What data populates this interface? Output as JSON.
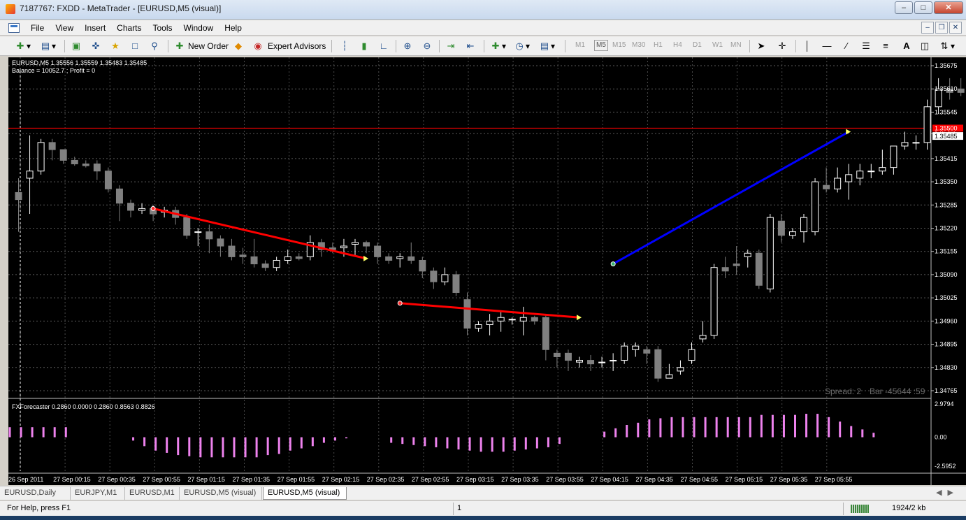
{
  "window": {
    "title": "7187767: FXDD - MetaTrader - [EURUSD,M5 (visual)]"
  },
  "menu": [
    "File",
    "View",
    "Insert",
    "Charts",
    "Tools",
    "Window",
    "Help"
  ],
  "toolbar": {
    "new_order": "New Order",
    "expert_advisors": "Expert Advisors",
    "timeframes": [
      "M1",
      "M5",
      "M15",
      "M30",
      "H1",
      "H4",
      "D1",
      "W1",
      "MN"
    ],
    "text_tool": "A"
  },
  "chart": {
    "info_line": "EURUSD,M5  1.35556 1.35559 1.35483 1.35485",
    "balance_line": "Balance = 10052.7 ; Profit = 0",
    "spread_text": "Spread: 2",
    "bar_text": "Bar  -45644 :59",
    "current_price": "1.35485",
    "price_line_label": "1.35500",
    "price_ticks": [
      "1.35675",
      "1.35610",
      "1.35545",
      "1.35485",
      "1.35415",
      "1.35350",
      "1.35285",
      "1.35220",
      "1.35155",
      "1.35090",
      "1.35025",
      "1.34960",
      "1.34895",
      "1.34830",
      "1.34765"
    ],
    "indicator_label": "FXForecaster 0.2860 0.0000 0.2860 0.8563 0.8826",
    "indicator_ticks": [
      "2.9794",
      "0.00",
      "-2.5952"
    ],
    "time_labels": [
      "26 Sep 2011",
      "27 Sep 00:15",
      "27 Sep 00:35",
      "27 Sep 00:55",
      "27 Sep 01:15",
      "27 Sep 01:35",
      "27 Sep 01:55",
      "27 Sep 02:15",
      "27 Sep 02:35",
      "27 Sep 02:55",
      "27 Sep 03:15",
      "27 Sep 03:35",
      "27 Sep 03:55",
      "27 Sep 04:15",
      "27 Sep 04:35",
      "27 Sep 04:55",
      "27 Sep 05:15",
      "27 Sep 05:35",
      "27 Sep 05:55"
    ],
    "colors": {
      "up": "#ffffff",
      "down": "#808080",
      "loss_trade": "#ff0000",
      "win_trade": "#0000ff",
      "indicator": "#ee82ee",
      "price_line": "#ff0000"
    },
    "candles": [
      [
        1.3532,
        1.353,
        1.3536,
        1.3521
      ],
      [
        1.3536,
        1.3538,
        1.3548,
        1.3526
      ],
      [
        1.3538,
        1.3546,
        1.3547,
        1.3537
      ],
      [
        1.3546,
        1.3544,
        1.3547,
        1.3541
      ],
      [
        1.3544,
        1.3541,
        1.3544,
        1.354
      ],
      [
        1.3541,
        1.354,
        1.3542,
        1.35395
      ],
      [
        1.354,
        1.35395,
        1.3541,
        1.3539
      ],
      [
        1.354,
        1.3538,
        1.3541,
        1.35355
      ],
      [
        1.3538,
        1.3533,
        1.3539,
        1.3532
      ],
      [
        1.3533,
        1.3529,
        1.3534,
        1.3524
      ],
      [
        1.3529,
        1.3527,
        1.353,
        1.3525
      ],
      [
        1.3527,
        1.35275,
        1.3529,
        1.3526
      ],
      [
        1.35275,
        1.3526,
        1.35285,
        1.3524
      ],
      [
        1.35265,
        1.3527,
        1.3528,
        1.3525
      ],
      [
        1.3527,
        1.3525,
        1.3528,
        1.3523
      ],
      [
        1.3525,
        1.352,
        1.3526,
        1.3519
      ],
      [
        1.3521,
        1.3521,
        1.3522,
        1.3517
      ],
      [
        1.3521,
        1.3519,
        1.3523,
        1.3515
      ],
      [
        1.3519,
        1.3517,
        1.352,
        1.3514
      ],
      [
        1.3517,
        1.3514,
        1.3519,
        1.3513
      ],
      [
        1.35145,
        1.3514,
        1.35165,
        1.3512
      ],
      [
        1.3514,
        1.3512,
        1.3519,
        1.3511
      ],
      [
        1.3512,
        1.3511,
        1.3513,
        1.351
      ],
      [
        1.3511,
        1.3513,
        1.3514,
        1.351
      ],
      [
        1.3513,
        1.3514,
        1.3516,
        1.3512
      ],
      [
        1.3514,
        1.35135,
        1.3515,
        1.3513
      ],
      [
        1.3514,
        1.3518,
        1.352,
        1.3513
      ],
      [
        1.3518,
        1.3516,
        1.3519,
        1.3514
      ],
      [
        1.35165,
        1.3516,
        1.3518,
        1.3515
      ],
      [
        1.35165,
        1.3517,
        1.3519,
        1.3514
      ],
      [
        1.35175,
        1.3518,
        1.3519,
        1.3514
      ],
      [
        1.3518,
        1.3517,
        1.35185,
        1.3515
      ],
      [
        1.3517,
        1.3514,
        1.3518,
        1.3512
      ],
      [
        1.3514,
        1.3513,
        1.3515,
        1.3512
      ],
      [
        1.35135,
        1.3514,
        1.3515,
        1.3511
      ],
      [
        1.3514,
        1.3513,
        1.3518,
        1.3512
      ],
      [
        1.3513,
        1.351,
        1.3514,
        1.3508
      ],
      [
        1.351,
        1.3507,
        1.3511,
        1.3505
      ],
      [
        1.3507,
        1.3509,
        1.3511,
        1.3506
      ],
      [
        1.3509,
        1.3504,
        1.351,
        1.3503
      ],
      [
        1.3502,
        1.3494,
        1.3504,
        1.3492
      ],
      [
        1.3494,
        1.3495,
        1.3496,
        1.3493
      ],
      [
        1.3495,
        1.3496,
        1.3498,
        1.3492
      ],
      [
        1.3496,
        1.3497,
        1.3499,
        1.3493
      ],
      [
        1.34965,
        1.34965,
        1.3497,
        1.3495
      ],
      [
        1.3496,
        1.3497,
        1.35,
        1.3492
      ],
      [
        1.3497,
        1.3496,
        1.34975,
        1.3495
      ],
      [
        1.3497,
        1.3488,
        1.3498,
        1.3485
      ],
      [
        1.3487,
        1.3486,
        1.3488,
        1.3483
      ],
      [
        1.3487,
        1.3485,
        1.3488,
        1.3482
      ],
      [
        1.34845,
        1.3485,
        1.3486,
        1.3483
      ],
      [
        1.3485,
        1.3484,
        1.34865,
        1.3482
      ],
      [
        1.34845,
        1.34845,
        1.3486,
        1.3483
      ],
      [
        1.3485,
        1.3485,
        1.3487,
        1.3482
      ],
      [
        1.3485,
        1.3489,
        1.349,
        1.3484
      ],
      [
        1.3488,
        1.3489,
        1.349,
        1.3486
      ],
      [
        1.3488,
        1.3487,
        1.3489,
        1.3484
      ],
      [
        1.3488,
        1.348,
        1.3489,
        1.3479
      ],
      [
        1.348,
        1.3481,
        1.3484,
        1.348
      ],
      [
        1.3482,
        1.3483,
        1.3485,
        1.3481
      ],
      [
        1.3485,
        1.3488,
        1.349,
        1.3484
      ],
      [
        1.3491,
        1.3492,
        1.3496,
        1.349
      ],
      [
        1.3492,
        1.3511,
        1.3512,
        1.3491
      ],
      [
        1.3511,
        1.351,
        1.3514,
        1.3508
      ],
      [
        1.3512,
        1.35115,
        1.3517,
        1.3509
      ],
      [
        1.3514,
        1.3515,
        1.3516,
        1.3511
      ],
      [
        1.3515,
        1.3506,
        1.3516,
        1.3505
      ],
      [
        1.3505,
        1.3525,
        1.3526,
        1.3504
      ],
      [
        1.3524,
        1.352,
        1.3526,
        1.3518
      ],
      [
        1.352,
        1.3521,
        1.3522,
        1.3519
      ],
      [
        1.3521,
        1.3525,
        1.3526,
        1.3518
      ],
      [
        1.3521,
        1.3535,
        1.3536,
        1.352
      ],
      [
        1.3534,
        1.3533,
        1.3539,
        1.3532
      ],
      [
        1.3533,
        1.3536,
        1.3539,
        1.3532
      ],
      [
        1.3535,
        1.3537,
        1.354,
        1.353
      ],
      [
        1.3536,
        1.3538,
        1.354,
        1.3534
      ],
      [
        1.3538,
        1.3538,
        1.354,
        1.3536
      ],
      [
        1.3538,
        1.3539,
        1.3544,
        1.3537
      ],
      [
        1.3539,
        1.3545,
        1.3545,
        1.3537
      ],
      [
        1.3545,
        1.3546,
        1.3549,
        1.3544
      ],
      [
        1.3546,
        1.3546,
        1.3548,
        1.3544
      ],
      [
        1.3546,
        1.3556,
        1.3558,
        1.3544
      ],
      [
        1.3556,
        1.3561,
        1.3564,
        1.3554
      ],
      [
        1.3561,
        1.356,
        1.3564,
        1.3558
      ],
      [
        1.3561,
        1.356,
        1.3564,
        1.3559
      ],
      [
        1.356,
        1.3553,
        1.3561,
        1.3552
      ],
      [
        1.3553,
        1.3554,
        1.3555,
        1.3551
      ],
      [
        1.3554,
        1.35535,
        1.3555,
        1.3552
      ],
      [
        1.3554,
        1.3548,
        1.3555,
        1.3547
      ],
      [
        1.3548,
        1.3547,
        1.3549,
        1.3544
      ],
      [
        1.355,
        1.3552,
        1.3553,
        1.3548
      ],
      [
        1.3553,
        1.3554,
        1.3561,
        1.3551
      ],
      [
        1.35556,
        1.35485,
        1.35559,
        1.35483
      ]
    ],
    "trades": [
      {
        "type": "loss",
        "open": 1.35275,
        "close": 1.35135
      },
      {
        "type": "loss",
        "open": 1.3501,
        "close": 1.3497
      },
      {
        "type": "win",
        "open": 1.3512,
        "close": 1.3549
      }
    ],
    "indicator_values": [
      0.9,
      0.9,
      0.9,
      0.9,
      0.9,
      0.9,
      0,
      0,
      0,
      0,
      0,
      -0.3,
      -0.8,
      -1.2,
      -1.4,
      -1.6,
      -1.7,
      -1.8,
      -1.8,
      -1.8,
      -1.8,
      -1.8,
      -1.8,
      -1.6,
      -1.5,
      -1.2,
      -1.0,
      -0.8,
      -0.5,
      -0.3,
      -0.1,
      0,
      0,
      0,
      -0.5,
      -0.6,
      -0.7,
      -0.8,
      -0.9,
      -1.0,
      -1.1,
      -1.2,
      -1.3,
      -1.3,
      -1.3,
      -1.2,
      -1.1,
      -1.0,
      -0.9,
      -0.6,
      0,
      0,
      0,
      0.5,
      0.8,
      1.1,
      1.3,
      1.6,
      1.7,
      1.8,
      1.8,
      1.8,
      1.8,
      1.8,
      1.8,
      1.8,
      1.8,
      2.0,
      2.0,
      2.0,
      2.0,
      2.1,
      2.1,
      1.8,
      1.4,
      1.0,
      0.7,
      0.4
    ]
  },
  "tabs": [
    "EURUSD,Daily",
    "EURJPY,M1",
    "EURUSD,M1",
    "EURUSD,M5 (visual)",
    "EURUSD,M5 (visual)"
  ],
  "status": {
    "help": "For Help, press F1",
    "field": "1",
    "traffic": "1924/2 kb"
  }
}
